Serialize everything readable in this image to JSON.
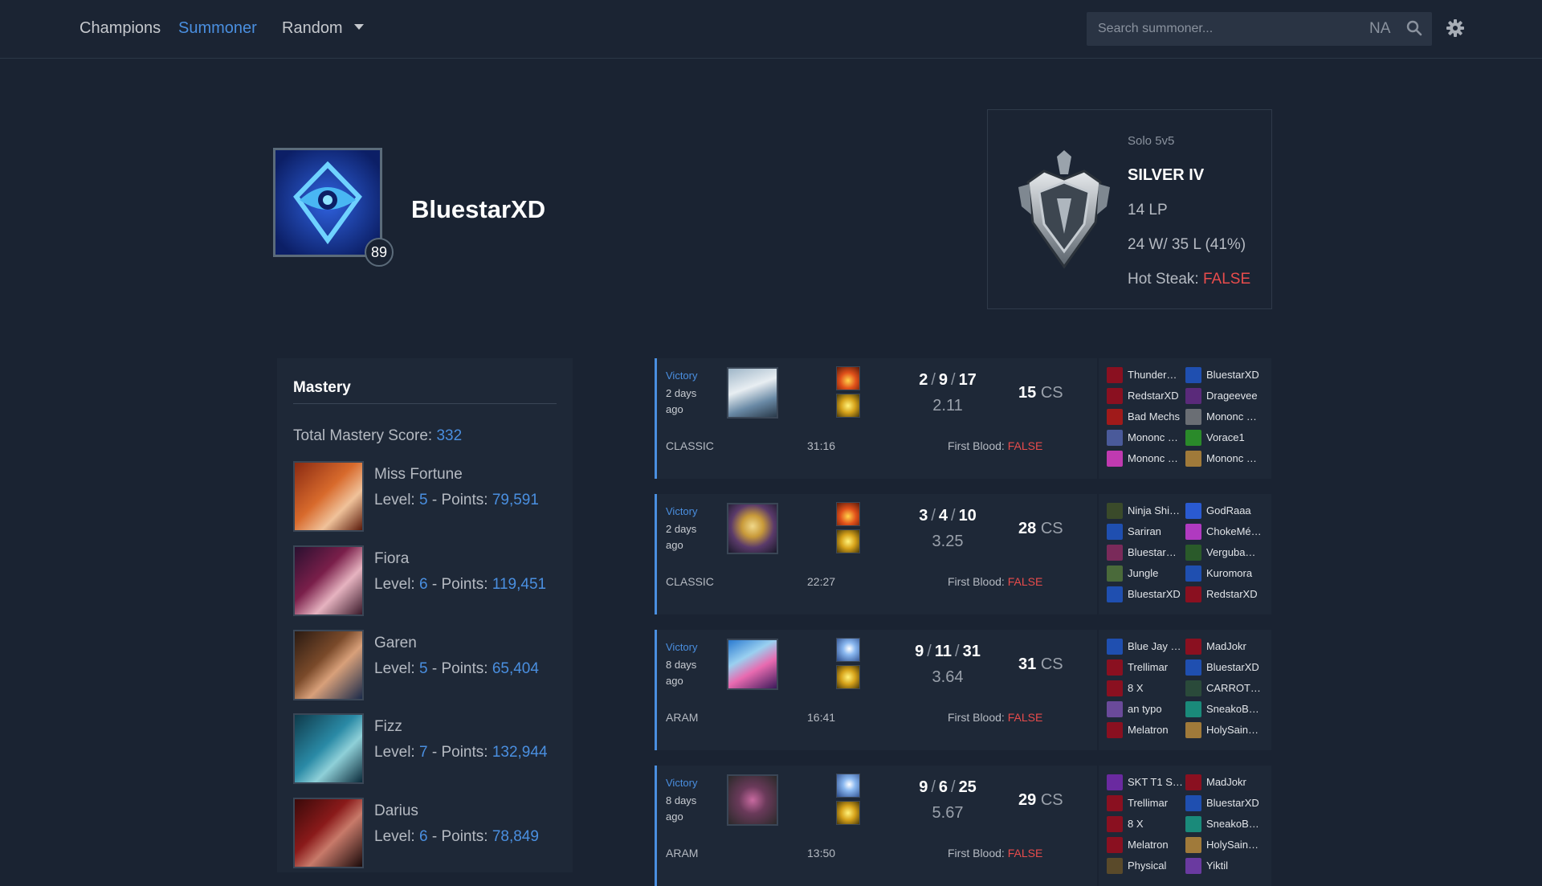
{
  "nav": {
    "champions": "Champions",
    "summoner": "Summoner",
    "random": "Random",
    "search_placeholder": "Search summoner...",
    "region": "NA"
  },
  "profile": {
    "name": "BluestarXD",
    "level": "89"
  },
  "rank": {
    "queue": "Solo 5v5",
    "tier": "SILVER IV",
    "lp": "14 LP",
    "record": "24 W/ 35 L (41%)",
    "hot_label": "Hot Steak:",
    "hot_value": "FALSE"
  },
  "mastery": {
    "title": "Mastery",
    "total_label": "Total Mastery Score:",
    "total_value": "332",
    "level_label": "Level:",
    "points_label": "- Points:",
    "champions": [
      {
        "name": "Miss Fortune",
        "level": "5",
        "points": "79,591"
      },
      {
        "name": "Fiora",
        "level": "6",
        "points": "119,451"
      },
      {
        "name": "Garen",
        "level": "5",
        "points": "65,404"
      },
      {
        "name": "Fizz",
        "level": "7",
        "points": "132,944"
      },
      {
        "name": "Darius",
        "level": "6",
        "points": "78,849"
      }
    ]
  },
  "match_labels": {
    "first_blood": "First Blood:",
    "cs_suffix": "CS",
    "slash": "/"
  },
  "matches": [
    {
      "result": "Victory",
      "ago": "2 days ago",
      "kills": "2",
      "deaths": "9",
      "assists": "17",
      "ratio": "2.11",
      "cs": "15",
      "mode": "CLASSIC",
      "duration": "31:16",
      "first_blood": "FALSE",
      "players": [
        "Thunder…",
        "BluestarXD",
        "RedstarXD",
        "Drageevee",
        "Bad Mechs",
        "Mononc …",
        "Mononc …",
        "Vorace1",
        "Mononc …",
        "Mononc …"
      ]
    },
    {
      "result": "Victory",
      "ago": "2 days ago",
      "kills": "3",
      "deaths": "4",
      "assists": "10",
      "ratio": "3.25",
      "cs": "28",
      "mode": "CLASSIC",
      "duration": "22:27",
      "first_blood": "FALSE",
      "players": [
        "Ninja Shi…",
        "GodRaaa",
        "Sariran",
        "ChokeMé…",
        "Bluestar…",
        "Verguba…",
        "Jungle",
        "Kuromora",
        "BluestarXD",
        "RedstarXD"
      ]
    },
    {
      "result": "Victory",
      "ago": "8 days ago",
      "kills": "9",
      "deaths": "11",
      "assists": "31",
      "ratio": "3.64",
      "cs": "31",
      "mode": "ARAM",
      "duration": "16:41",
      "first_blood": "FALSE",
      "players": [
        "Blue Jay …",
        "MadJokr",
        "Trellimar",
        "BluestarXD",
        "8 X",
        "CARROT…",
        "an typo",
        "SneakoB…",
        "Melatron",
        "HolySain…"
      ]
    },
    {
      "result": "Victory",
      "ago": "8 days ago",
      "kills": "9",
      "deaths": "6",
      "assists": "25",
      "ratio": "5.67",
      "cs": "29",
      "mode": "ARAM",
      "duration": "13:50",
      "first_blood": "FALSE",
      "players": [
        "SKT T1 S…",
        "MadJokr",
        "Trellimar",
        "BluestarXD",
        "8 X",
        "SneakoB…",
        "Melatron",
        "HolySain…",
        "Physical",
        "Yiktil"
      ]
    }
  ],
  "colors": {
    "background": "#1a2332",
    "panel": "#1e2837",
    "accent": "#4a8fe0",
    "negative": "#e84c4c"
  }
}
